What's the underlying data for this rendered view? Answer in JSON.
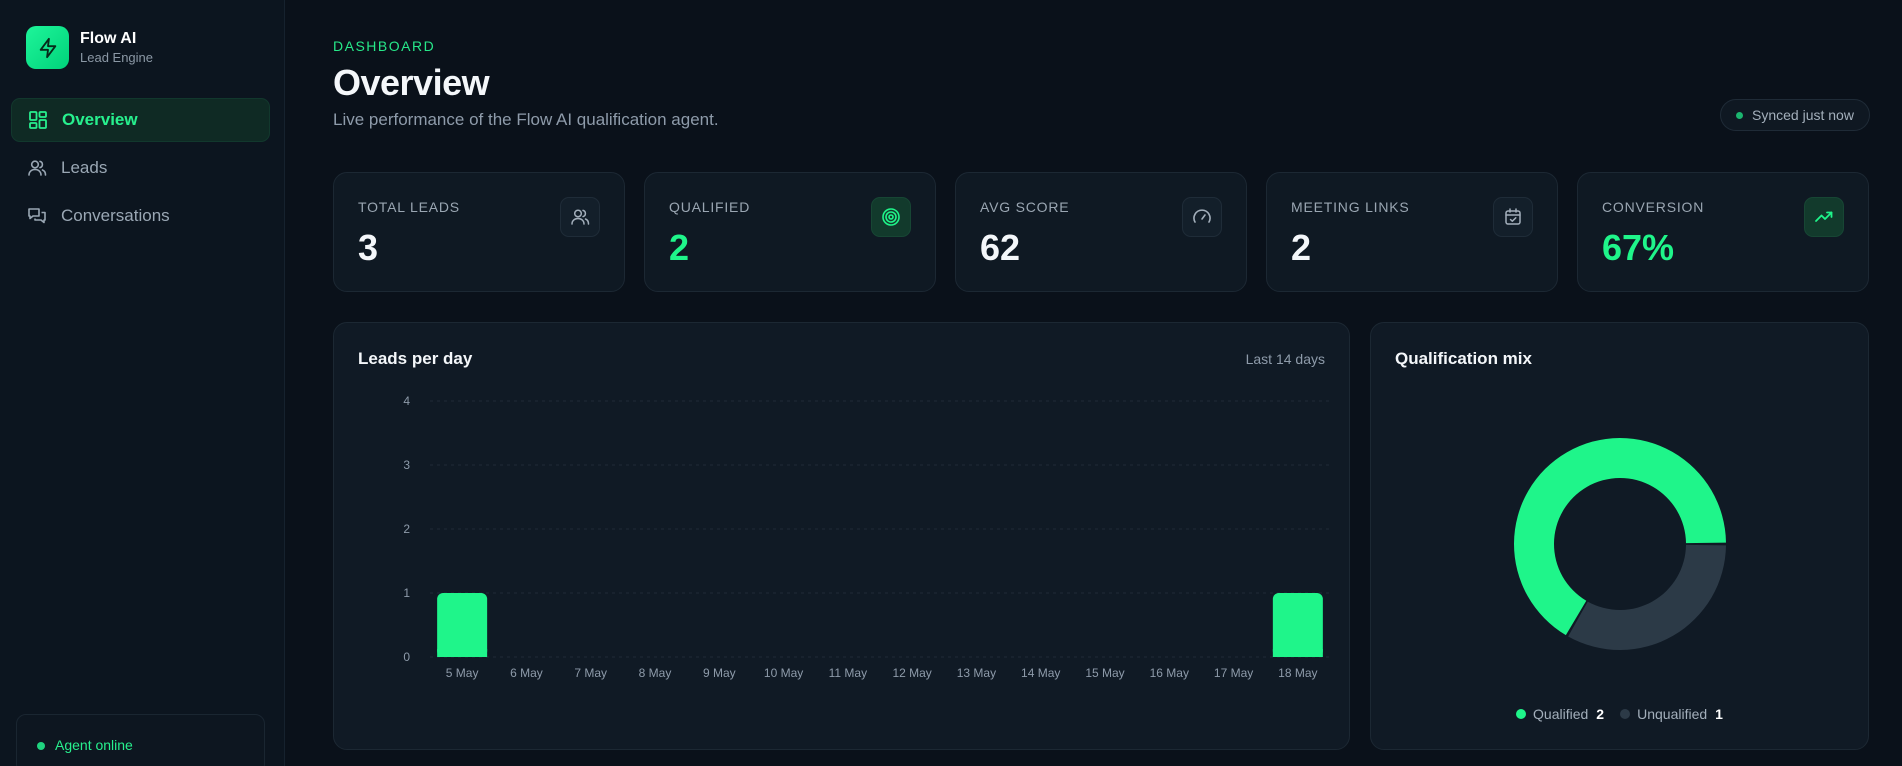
{
  "brand": {
    "name": "Flow AI",
    "subtitle": "Lead Engine"
  },
  "sidebar": {
    "items": [
      {
        "label": "Overview",
        "icon": "grid-icon",
        "active": true
      },
      {
        "label": "Leads",
        "icon": "users-icon",
        "active": false
      },
      {
        "label": "Conversations",
        "icon": "chat-icon",
        "active": false
      }
    ],
    "agent_status": "Agent online"
  },
  "header": {
    "eyebrow": "DASHBOARD",
    "title": "Overview",
    "subtitle": "Live performance of the Flow AI qualification agent.",
    "sync_status": "Synced just now"
  },
  "stats": [
    {
      "label": "TOTAL LEADS",
      "value": "3",
      "icon": "users-icon",
      "accent": false
    },
    {
      "label": "QUALIFIED",
      "value": "2",
      "icon": "target-icon",
      "accent": true
    },
    {
      "label": "AVG SCORE",
      "value": "62",
      "icon": "gauge-icon",
      "accent": false
    },
    {
      "label": "MEETING LINKS",
      "value": "2",
      "icon": "calendar-check-icon",
      "accent": false
    },
    {
      "label": "CONVERSION",
      "value": "67%",
      "icon": "trending-up-icon",
      "accent": true
    }
  ],
  "leads_panel": {
    "title": "Leads per day",
    "range": "Last 14 days"
  },
  "mix_panel": {
    "title": "Qualification mix"
  },
  "colors": {
    "accent": "#1ff58a",
    "muted": "#2c3a47",
    "background": "#0a111a"
  },
  "chart_data": [
    {
      "type": "bar",
      "title": "Leads per day",
      "categories": [
        "5 May",
        "6 May",
        "7 May",
        "8 May",
        "9 May",
        "10 May",
        "11 May",
        "12 May",
        "13 May",
        "14 May",
        "15 May",
        "16 May",
        "17 May",
        "18 May"
      ],
      "values": [
        1,
        0,
        0,
        0,
        0,
        0,
        0,
        0,
        0,
        0,
        0,
        0,
        0,
        1
      ],
      "ylim": [
        0,
        4
      ],
      "yticks": [
        0,
        1,
        2,
        3,
        4
      ],
      "grid": true
    },
    {
      "type": "pie",
      "title": "Qualification mix",
      "donut": true,
      "labels": [
        "Qualified",
        "Unqualified"
      ],
      "values": [
        2,
        1
      ],
      "colors": [
        "#1ff58a",
        "#2c3a47"
      ],
      "legend": "bottom"
    }
  ]
}
